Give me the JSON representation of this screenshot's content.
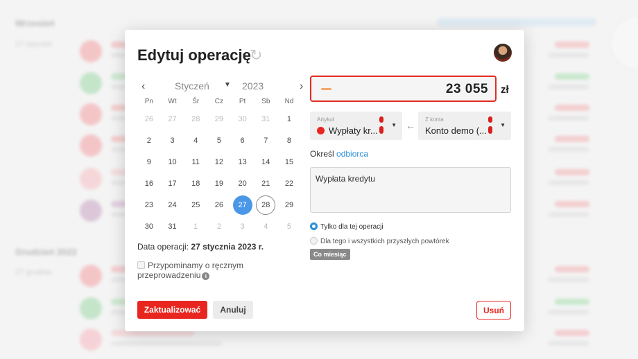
{
  "background": {
    "groups": [
      {
        "title": "Wrzesień",
        "date": "27 styczeń"
      },
      {
        "title": "Grudzień 2022",
        "date": "27 grudnia"
      }
    ]
  },
  "modal": {
    "title": "Edytuj operację",
    "amount": "23 055",
    "currency": "zł",
    "article": {
      "label": "Artykuł",
      "value": "Wypłaty kr..."
    },
    "account": {
      "label": "Z konta",
      "value": "Konto demo (..."
    },
    "recipient": {
      "prefix": "Określ",
      "link": "odbiorca"
    },
    "description": "Wypłata kredytu",
    "options": {
      "only_this": "Tylko dla tej operacji",
      "all_future": "Dla tego i wszystkich przyszłych powtórek",
      "frequency": "Co miesiąc"
    },
    "operation_date": {
      "label": "Data operacji:",
      "value": "27 stycznia 2023 r."
    },
    "reminder": "Przypominamy o ręcznym przeprowadzeniu",
    "buttons": {
      "update": "Zaktualizować",
      "cancel": "Anuluj",
      "delete": "Usuń"
    }
  },
  "calendar": {
    "month": "Styczeń",
    "year": "2023",
    "prev": "‹",
    "next": "›",
    "weekdays": [
      "Pn",
      "Wt",
      "Śr",
      "Cz",
      "Pt",
      "Sb",
      "Nd"
    ],
    "weeks": [
      [
        "26",
        "27",
        "28",
        "29",
        "30",
        "31",
        "1"
      ],
      [
        "2",
        "3",
        "4",
        "5",
        "6",
        "7",
        "8"
      ],
      [
        "9",
        "10",
        "11",
        "12",
        "13",
        "14",
        "15"
      ],
      [
        "16",
        "17",
        "18",
        "19",
        "20",
        "21",
        "22"
      ],
      [
        "23",
        "24",
        "25",
        "26",
        "27",
        "28",
        "29"
      ],
      [
        "30",
        "31",
        "1",
        "2",
        "3",
        "4",
        "5"
      ]
    ],
    "selected": "27",
    "today": "28"
  },
  "colors": {
    "accent": "#e8261f",
    "link": "#2a8fd6",
    "selected_day": "#4a97e8"
  }
}
